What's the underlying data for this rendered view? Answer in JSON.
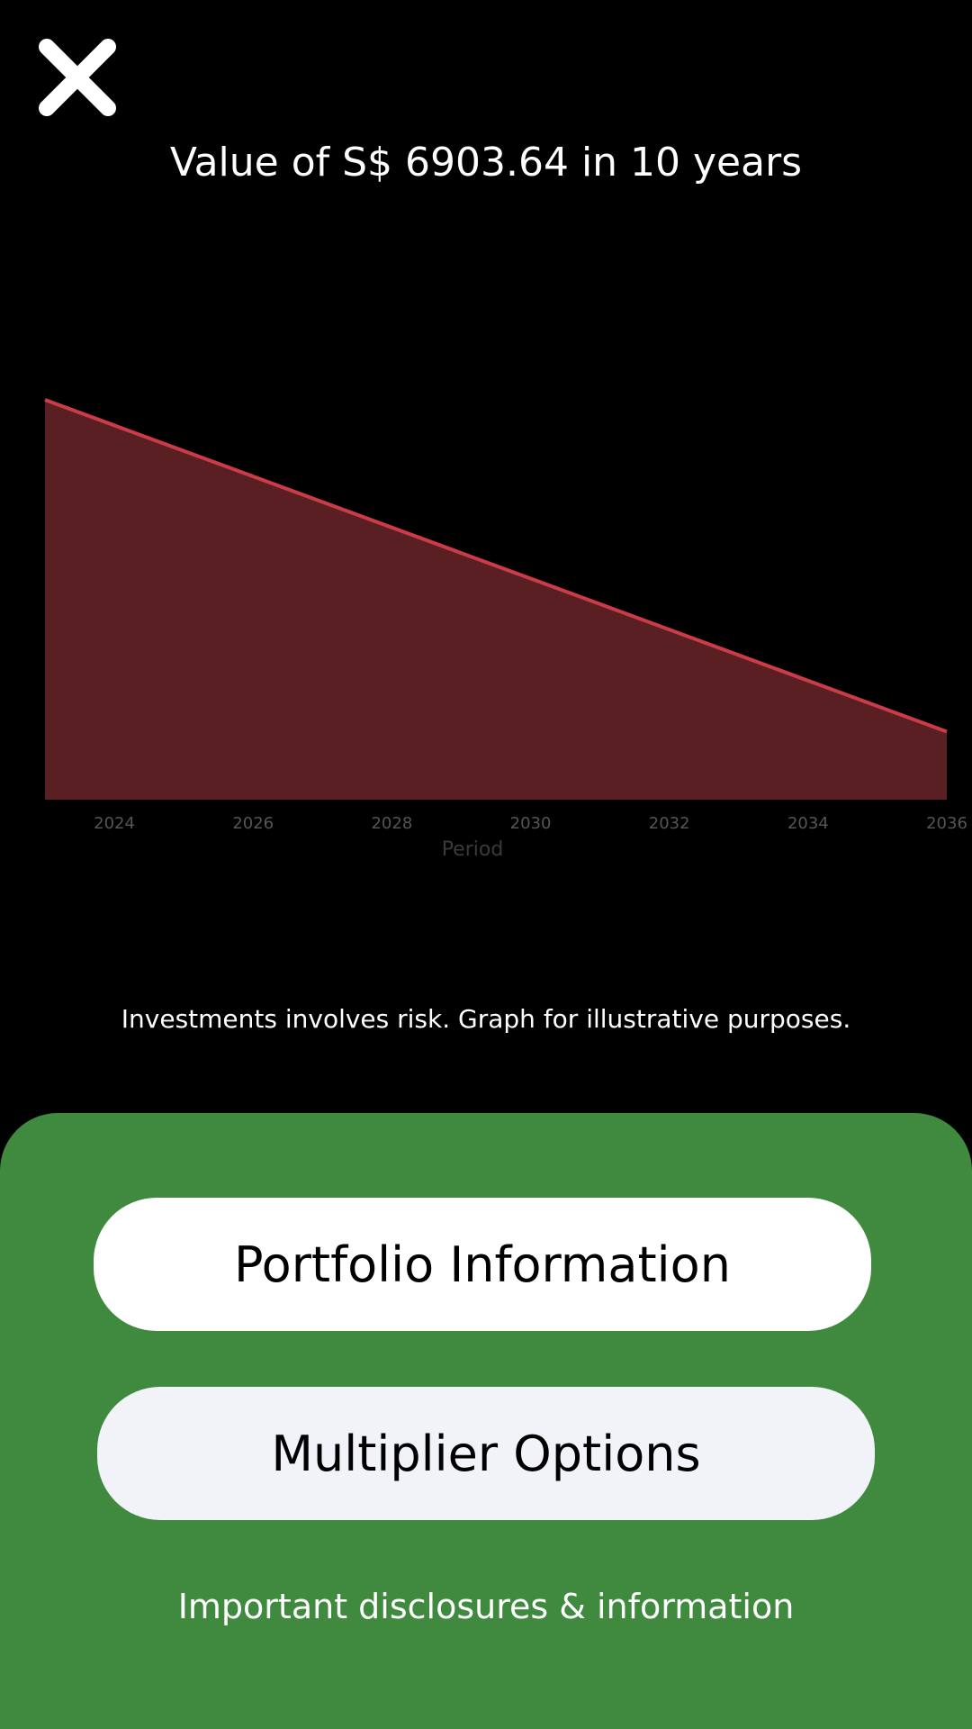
{
  "header": {
    "close_icon": "close-icon",
    "title": "Value of S$ 6903.64 in 10 years"
  },
  "chart_data": {
    "type": "area",
    "title": "",
    "xlabel": "Period",
    "ylabel": "",
    "x_ticks": [
      "2024",
      "2026",
      "2028",
      "2030",
      "2032",
      "2034",
      "2036"
    ],
    "x": [
      2023,
      2036
    ],
    "values": [
      1,
      0.17
    ],
    "grid": false,
    "colors": {
      "line": "#cc3b48",
      "fill": "#5a1f22",
      "tick_labels": "#555555",
      "axis_title": "#3a3a3a"
    }
  },
  "disclaimer": "Investments involves risk. Graph for illustrative purposes.",
  "actions": {
    "portfolio_label": "Portfolio Information",
    "multiplier_label": "Multiplier Options",
    "disclosures_label": "Important disclosures & information"
  },
  "colors": {
    "background": "#000000",
    "panel": "#3f8a3f",
    "button_primary": "#ffffff",
    "button_secondary": "#f1f3f8"
  }
}
